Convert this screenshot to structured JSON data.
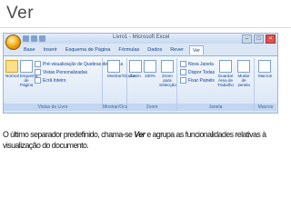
{
  "slide": {
    "title": "Ver",
    "caption_before": "O último separador predefinido, chama-se ",
    "caption_emphasis": "Ver",
    "caption_after": " e agrupa as funcionalidades relativas à visualização do documento."
  },
  "window": {
    "title": "Livro1 - Microsoft Excel"
  },
  "tabs": [
    {
      "label": "Base"
    },
    {
      "label": "Inserir"
    },
    {
      "label": "Esquema de Página"
    },
    {
      "label": "Fórmulas"
    },
    {
      "label": "Dados"
    },
    {
      "label": "Rever"
    },
    {
      "label": "Ver",
      "active": true
    }
  ],
  "ribbon": {
    "group1": {
      "label": "Vistas de Livro",
      "normal": "Normal",
      "page_layout": "Esquema de Página",
      "break_preview": "Pré-visualização de Quebras de Página",
      "custom_views": "Vistas Personalizadas",
      "full_screen": "Ecrã Inteiro"
    },
    "group2": {
      "label": "Mostrar/Ocultar",
      "button": "Mostrar/Ocultar"
    },
    "group3": {
      "label": "Zoom",
      "zoom": "Zoom",
      "zoom100": "100%",
      "zoom_selection": "Zoom para Selecção"
    },
    "group4": {
      "label": "Janela",
      "new_window": "Nova Janela",
      "arrange_all": "Dispor Todas",
      "freeze_panes": "Fixar Painéis",
      "save_workspace": "Guardar Área de Trabalho",
      "switch_windows": "Mudar de Janela"
    },
    "group5": {
      "label": "Macros",
      "macros": "Macros"
    }
  }
}
